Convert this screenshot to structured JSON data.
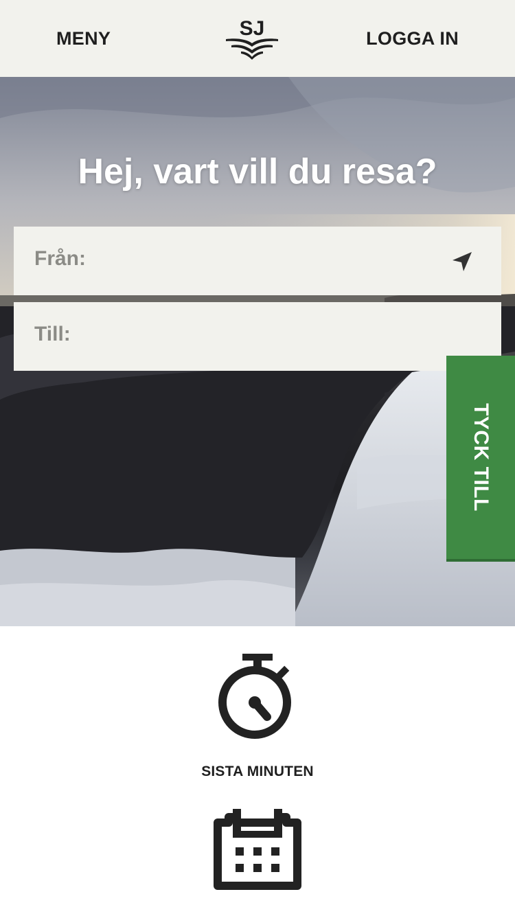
{
  "header": {
    "menu_label": "MENY",
    "login_label": "LOGGA IN",
    "logo_text": "SJ"
  },
  "hero": {
    "title": "Hej, vart vill du resa?"
  },
  "search": {
    "from_label": "Från:",
    "to_label": "Till:",
    "location_icon": "navigation-arrow-icon"
  },
  "feedback": {
    "label": "TYCK TILL",
    "color": "#3f8a44"
  },
  "quick_links": {
    "last_minute": {
      "label": "SISTA MINUTEN",
      "icon": "stopwatch-icon"
    },
    "calendar": {
      "icon": "calendar-icon"
    }
  },
  "colors": {
    "header_bg": "#f2f2ed",
    "text_dark": "#1f1f1f",
    "field_label": "#8b8b86"
  }
}
